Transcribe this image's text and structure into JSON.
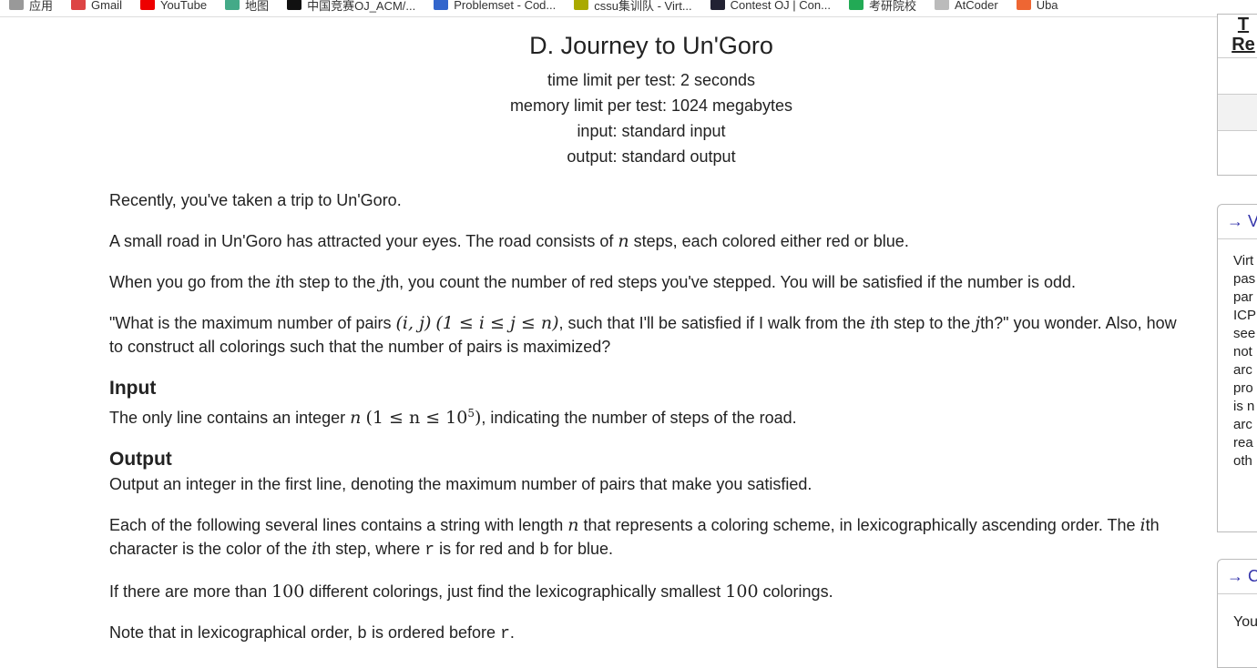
{
  "bookmarks": [
    {
      "label": "应用",
      "color": "#999"
    },
    {
      "label": "Gmail",
      "color": "#d44"
    },
    {
      "label": "YouTube",
      "color": "#e00"
    },
    {
      "label": "地图",
      "color": "#4a8"
    },
    {
      "label": "中国竞赛OJ_ACM/...",
      "color": "#111"
    },
    {
      "label": "Problemset - Cod...",
      "color": "#36c"
    },
    {
      "label": "cssu集训队 - Virt...",
      "color": "#aa0"
    },
    {
      "label": "Contest OJ | Con...",
      "color": "#223"
    },
    {
      "label": "考研院校",
      "color": "#2a5"
    },
    {
      "label": "AtCoder",
      "color": "#bbb"
    },
    {
      "label": "Uba",
      "color": "#e63"
    }
  ],
  "problem": {
    "title": "D. Journey to Un'Goro",
    "limits": [
      "time limit per test: 2 seconds",
      "memory limit per test: 1024 megabytes",
      "input: standard input",
      "output: standard output"
    ],
    "p1": "Recently, you've taken a trip to Un'Goro.",
    "p2a": "A small road in Un'Goro has attracted your eyes. The road consists of ",
    "n": "n",
    "p2b": " steps, each colored either red or blue.",
    "p3a": "When you go from the ",
    "i": "i",
    "p3b": "th step to the ",
    "j": "j",
    "p3c": "th, you count the number of red steps you've stepped. You will be satisfied if the number is odd.",
    "p4a": "\"What is the maximum number of pairs ",
    "pair": "(i, j)",
    "cond": "(1 ≤ i ≤ j ≤ n)",
    "p4b": ", such that I'll be satisfied if I walk from the ",
    "p4c": "th step to the ",
    "p4d": "th?\" you wonder. Also, how to construct all colorings such that the number of pairs is maximized?",
    "input_title": "Input",
    "in_a": "The only line contains an integer ",
    "in_cond": "(1 ≤ n ≤ 10",
    "in_exp": "5",
    "in_close": ")",
    "in_b": ", indicating the number of steps of the road.",
    "output_title": "Output",
    "out1": "Output an integer in the first line, denoting the maximum number of pairs that make you satisfied.",
    "out2a": "Each of the following several lines contains a string with length ",
    "out2b": " that represents a coloring scheme, in lexicographically ascending order. The ",
    "out2c": "th character is the color of the ",
    "out2d": "th step, where ",
    "r": "r",
    "out2e": " is for red and ",
    "b": "b",
    "out2f": " for blue.",
    "out3a": "If there are more than ",
    "hundred": "100",
    "out3b": " different colorings, just find the lexicographically smallest ",
    "out3c": " colorings.",
    "out4a": "Note that in lexicographical order, ",
    "out4b": " is ordered before ",
    "out4c": "."
  },
  "sidebar": {
    "top_heading": [
      "T",
      "Re"
    ],
    "virtual_heading": "→ V",
    "virtual_text": [
      "Virt",
      "pas",
      "par",
      "ICP",
      "see",
      "not",
      "arc",
      "pro",
      "is n",
      "arc",
      "rea",
      "oth"
    ],
    "third_heading": "→ C",
    "third_text": "You"
  }
}
